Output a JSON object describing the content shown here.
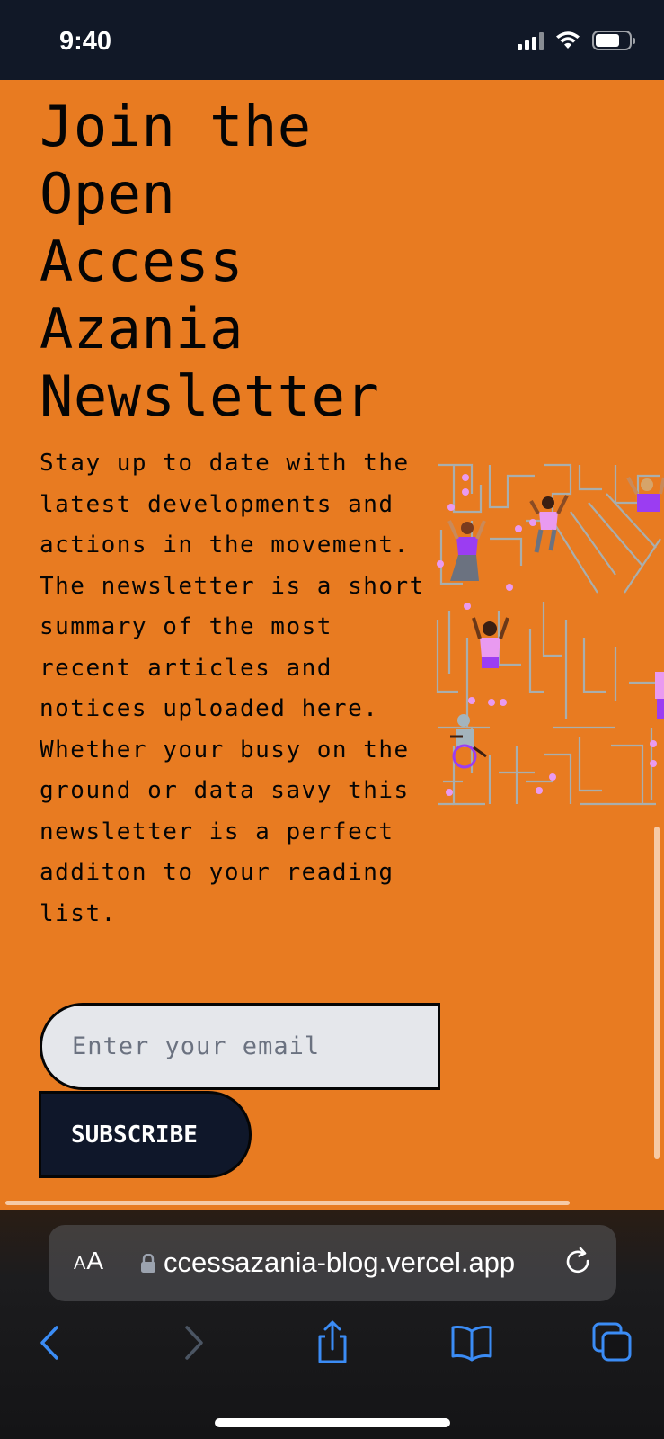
{
  "status_bar": {
    "time": "9:40",
    "icons": [
      "signal-icon",
      "wifi-icon",
      "battery-icon"
    ]
  },
  "newsletter": {
    "headline": "Join the\nOpen\nAccess\nAzania\nNewsletter",
    "description": "Stay up to date with the latest developments and actions in the movement. The newsletter is a short summary of the most recent articles and notices uploaded here. Whether your busy on the ground or data savy this newsletter is a perfect additon to your reading list.",
    "email_placeholder": "Enter your email",
    "email_value": "",
    "subscribe_label": "SUBSCRIBE",
    "illustration": "maze-people-illustration"
  },
  "browser": {
    "text_size_label_small": "A",
    "text_size_label_large": "A",
    "url": "ccessazania-blog.vercel.app",
    "toolbar": [
      "back-icon",
      "forward-icon",
      "share-icon",
      "bookmarks-icon",
      "tabs-icon"
    ]
  },
  "colors": {
    "page_background": "#e87b21",
    "dark": "#0f172a",
    "input_background": "#e5e7eb",
    "accent_blue": "#3b8cf5",
    "figure_purple": "#9b3df2",
    "figure_pink": "#e99af0"
  }
}
